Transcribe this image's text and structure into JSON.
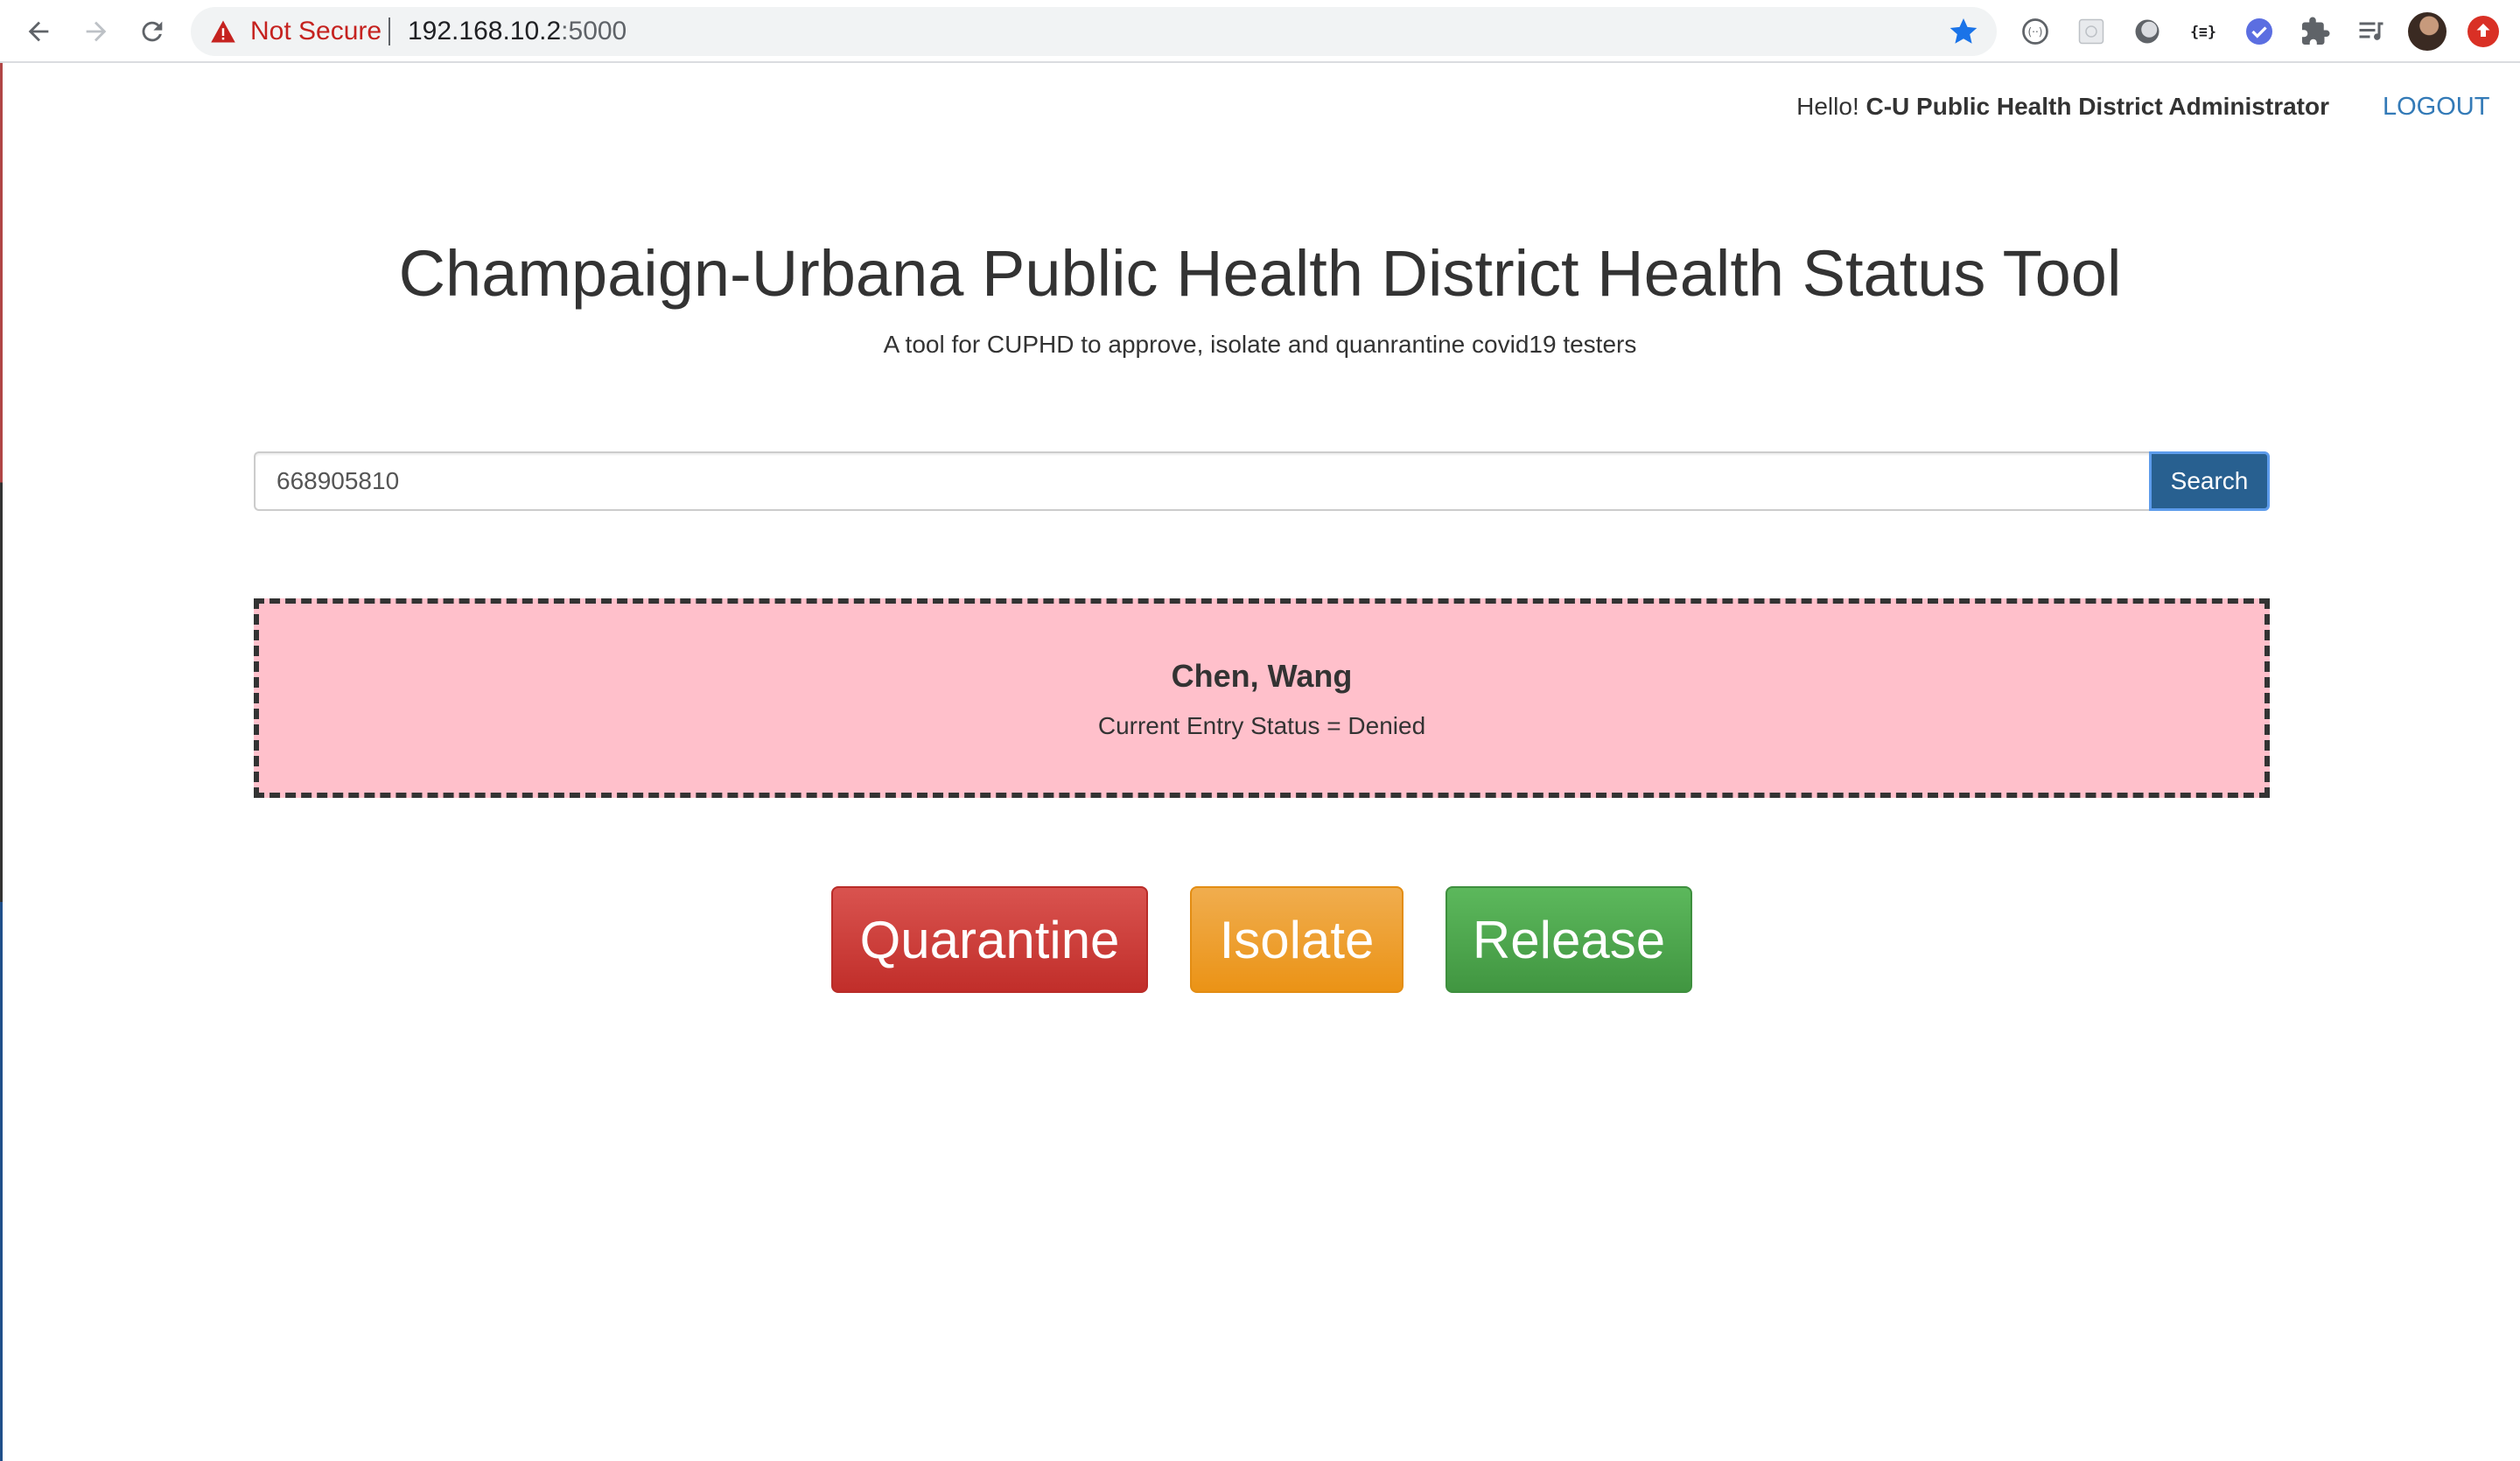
{
  "browser": {
    "security_label": "Not Secure",
    "url_host": "192.168.10.2",
    "url_port": ":5000",
    "icons": [
      "back-icon",
      "forward-icon",
      "reload-icon",
      "warning-icon",
      "bookmark-star-icon",
      "extension-icons",
      "puzzle-icon",
      "reading-list-icon",
      "profile-avatar",
      "update-icon"
    ],
    "accent_color": "#1a73e8"
  },
  "header": {
    "greeting_prefix": "Hello! ",
    "user_name": "C-U Public Health District Administrator",
    "logout_label": "LOGOUT"
  },
  "main": {
    "title": "Champaign-Urbana Public Health District Health Status Tool",
    "subtitle": "A tool for CUPHD to approve, isolate and quanrantine covid19 testers"
  },
  "search": {
    "value": "668905810",
    "button_label": "Search"
  },
  "result": {
    "name": "Chen, Wang",
    "status_text": "Current Entry Status = Denied",
    "background_color": "#ffc0cb"
  },
  "actions": {
    "quarantine_label": "Quarantine",
    "isolate_label": "Isolate",
    "release_label": "Release",
    "colors": {
      "quarantine": "#d9534f",
      "isolate": "#f0ad4e",
      "release": "#5cb85c"
    }
  }
}
